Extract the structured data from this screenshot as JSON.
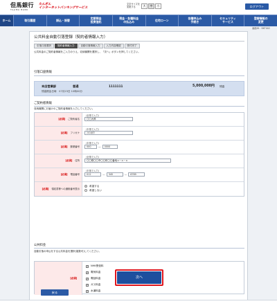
{
  "header": {
    "logo_jp": "但馬銀行",
    "logo_en": "TAJIMA BANK",
    "service_line1": "たんぎん",
    "service_line2": "インターネットバンキングサービス",
    "font_size_label1": "文字サイズを",
    "font_size_label2": "変更する",
    "font_size_options": [
      "大",
      "中",
      "小"
    ],
    "logout": "ログアウト"
  },
  "nav": {
    "items": [
      "ホーム",
      "取引履歴",
      "振込・振替",
      "定期預金\n投資信託",
      "税金・各種料金\nの払込み",
      "住宅ローン",
      "各種申込み\n手続き",
      "セキュリティ\nサービス",
      "登録情報の\n変更"
    ]
  },
  "page": {
    "screen_id": "画面ID：BKT002",
    "title": "公共料金自動引落登録（契約者情報入力）",
    "steps": [
      "引落口座選択",
      "契約者情報入力",
      "自動引落情報入力",
      "入力内容確認",
      "受付完了"
    ],
    "current_step": 1,
    "lead": "公共料金のご契約者情報をご入力のうえ、収納機関を選択し、「次へ」ボタンを押してください。"
  },
  "account": {
    "section_title": "引落口座情報",
    "branch": "本店営業部",
    "type": "普通",
    "number": "1111111",
    "balance": "5,000,000円",
    "balance_suffix": "残高",
    "balance_date": "残高照会日時　07月23日 10時00分"
  },
  "contract": {
    "section_title": "ご契約者情報",
    "note": "収納機関にお届けのご契約者情報を入力してください。",
    "required": "【必須】",
    "fields": {
      "name_label": "ご契約者名",
      "name_hint": "（全角で入力）",
      "name_value": "〇〇大郎",
      "kana_label": "フリガナ",
      "kana_hint": "（半角で入力）",
      "kana_value": "ﾏﾙﾏﾙﾀﾛｳ",
      "zip_label": "郵便番号",
      "zip_hint": "（半角で入力）",
      "zip1": "000",
      "zip2": "0000",
      "addr_label": "住所",
      "addr_hint": "（全角で入力）",
      "addr_value": "〇〇県〇〇市〇〇町〇〇番地×－×－×",
      "tel_label": "電話番号",
      "tel_hint": "（半角で入力）",
      "tel1": "012",
      "tel2": "345",
      "tel3": "6789",
      "notice_label": "領収書等への通帳番号表示",
      "notice_yes": "希望する",
      "notice_no": "希望しない"
    }
  },
  "fees": {
    "section_title": "公共料金",
    "note": "自動引落の申込をする公共料金を選択(複数可)してください。",
    "items": [
      "NHK受信料",
      "電気料金",
      "電話料金",
      "ガス料金",
      "水道料金"
    ]
  },
  "buttons": {
    "next": "次へ",
    "back": "戻る"
  }
}
